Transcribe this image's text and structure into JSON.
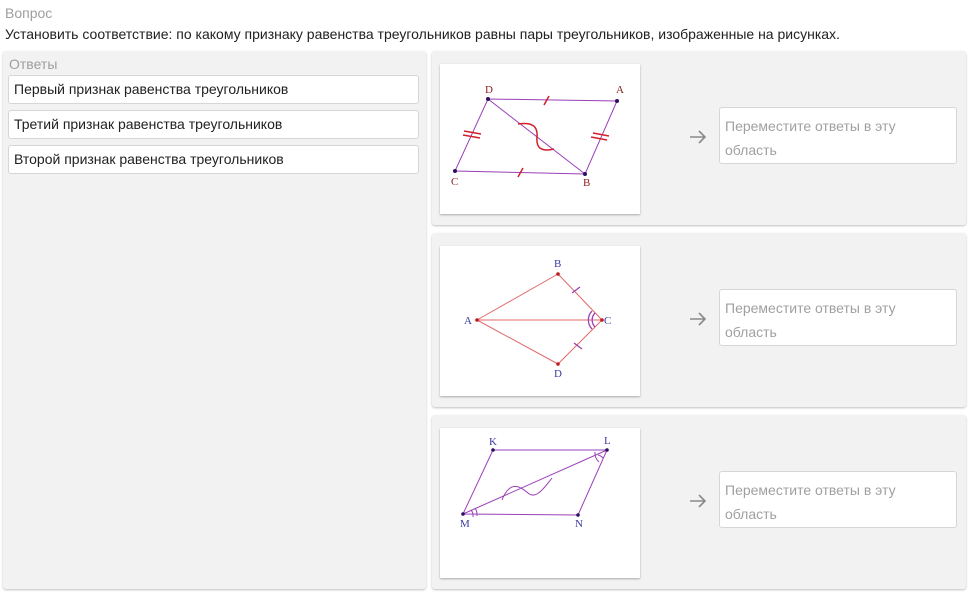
{
  "question": {
    "caption": "Вопрос",
    "text": "Установить соответствие: по какому признаку равенства треугольников равны пары треугольников, изображенные на рисунках."
  },
  "answers": {
    "title": "Ответы",
    "items": [
      {
        "label": "Первый признак равенства треугольников"
      },
      {
        "label": "Третий признак равенства треугольников"
      },
      {
        "label": "Второй признак равенства треугольников"
      }
    ]
  },
  "tasks": [
    {
      "figure_labels": {
        "D": "D",
        "A": "A",
        "C": "C",
        "B": "B"
      },
      "drop_placeholder": "Переместите ответы в эту область"
    },
    {
      "figure_labels": {
        "B": "B",
        "A": "A",
        "C": "C",
        "D": "D"
      },
      "drop_placeholder": "Переместите ответы в эту область"
    },
    {
      "figure_labels": {
        "K": "K",
        "L": "L",
        "M": "M",
        "N": "N"
      },
      "drop_placeholder": "Переместите ответы в эту область"
    }
  ],
  "colors": {
    "panel_bg": "#f2f2f2",
    "figure1_lines": "#9a40b8",
    "figure2_lines": "#e06a6a",
    "figure3_lines": "#9a40b8",
    "tick_marks": "#d21f2a",
    "label_figure1": "#8b1a1a",
    "label_figure2_3": "#3a3aa0"
  }
}
